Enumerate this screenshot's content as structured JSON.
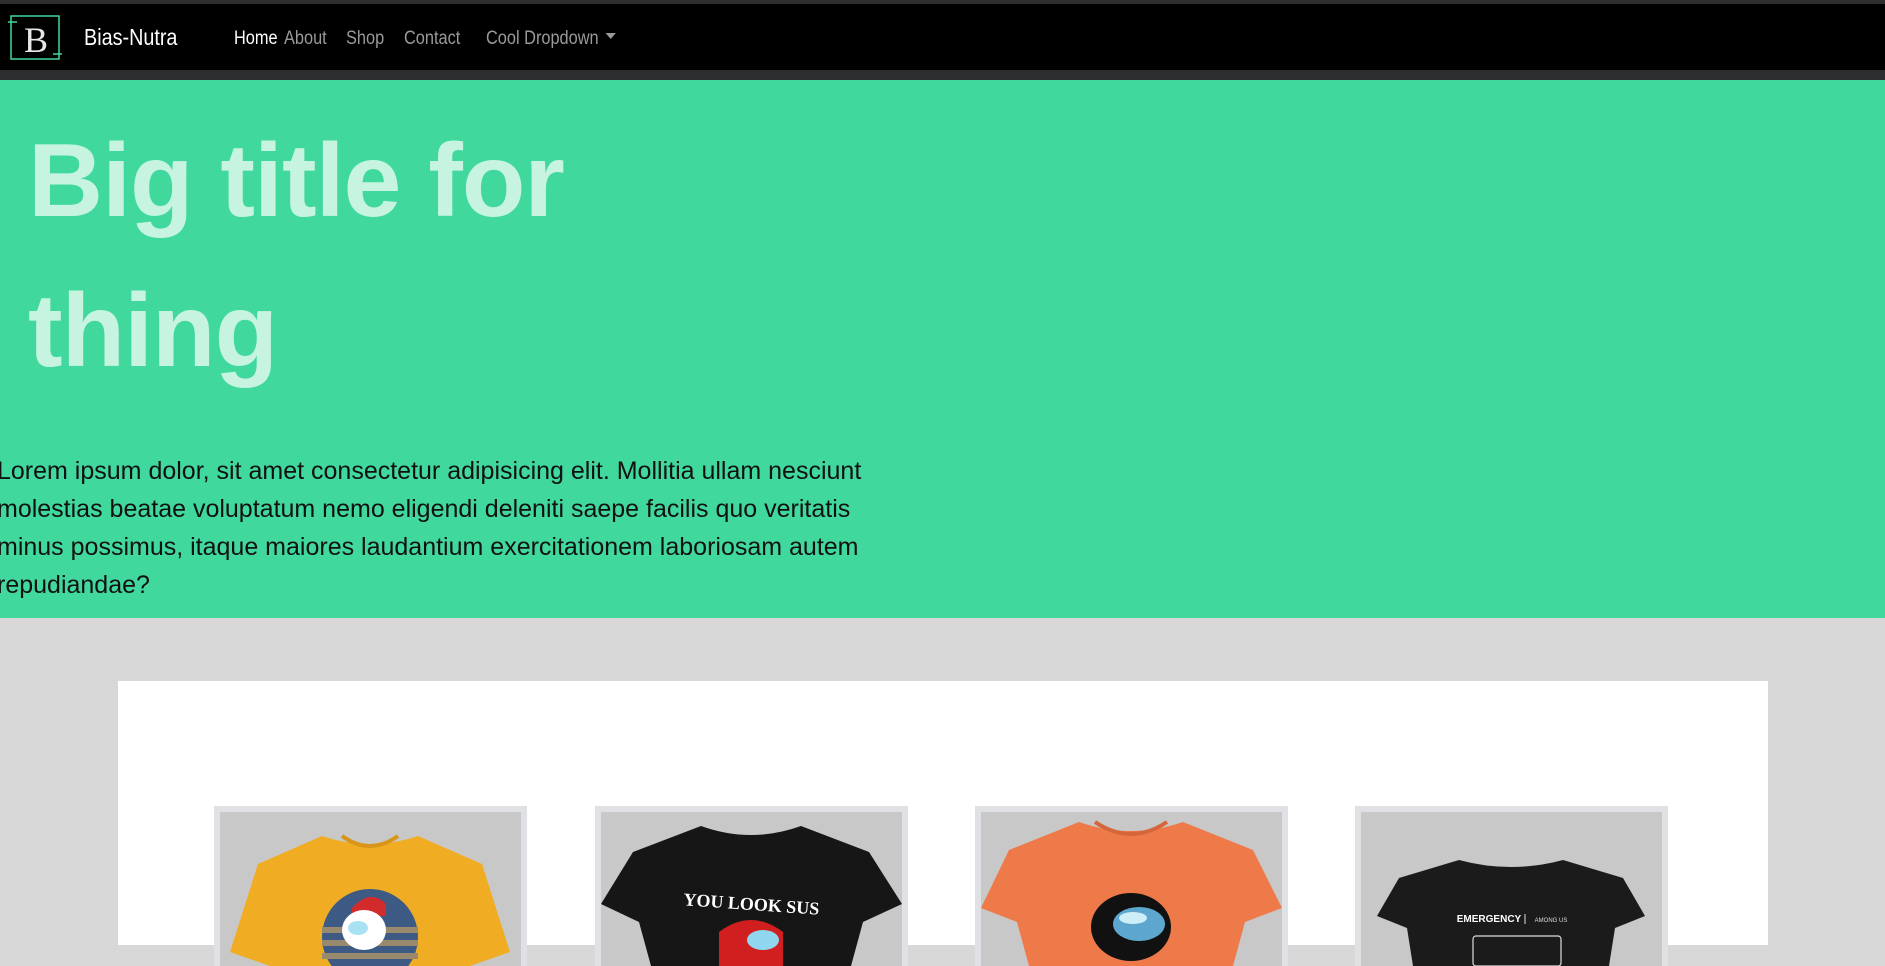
{
  "navbar": {
    "brand": "Bias-Nutra",
    "logo_letter": "B",
    "links": [
      {
        "label": "Home",
        "active": true
      },
      {
        "label": "About",
        "active": false
      },
      {
        "label": "Shop",
        "active": false
      },
      {
        "label": "Contact",
        "active": false
      },
      {
        "label": "Cool Dropdown",
        "active": false,
        "dropdown": true
      }
    ]
  },
  "hero": {
    "title_line1": "Big title for",
    "title_line2": "thing",
    "text": "Lorem ipsum dolor, sit amet consectetur adipisicing elit. Mollitia ullam nesciunt molestias beatae voluptatum nemo eligendi deleniti saepe facilis quo veritatis minus possimus, itaque maiores laudantium exercitationem laboriosam autem repudiandae?"
  },
  "products": [
    {
      "image": "yellow-tshirt-astronaut",
      "color": "#f0ad24"
    },
    {
      "image": "black-tshirt-you-look-sus",
      "color": "#161616",
      "print_text": "YOU LOOK SUS"
    },
    {
      "image": "orange-tshirt-crewmate",
      "color": "#ee7a4a"
    },
    {
      "image": "black-tshirt-emergency",
      "color": "#1b1b1b",
      "print_text": "EMERGENCY",
      "print_subtext": "AMONG US"
    }
  ],
  "colors": {
    "navbar_bg": "#000000",
    "hero_bg": "#40d89d",
    "hero_title": "#c6f4e1",
    "page_bg": "#d8d8d8",
    "accent_logo": "#40d89d"
  }
}
